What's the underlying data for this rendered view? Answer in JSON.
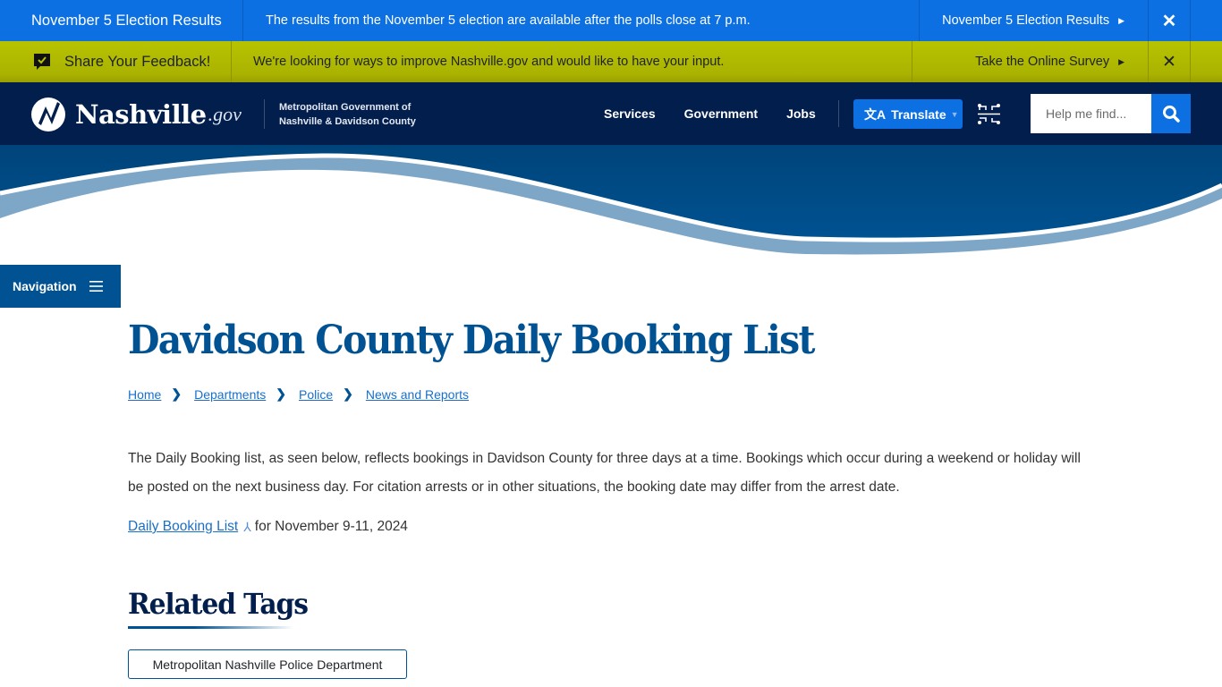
{
  "alerts": {
    "election": {
      "title": "November 5 Election Results",
      "message": "The results from the November 5 election are available after the polls close at 7 p.m.",
      "link_label": "November 5 Election Results",
      "close_label": "✕"
    },
    "feedback": {
      "title": "Share Your Feedback!",
      "message": "We're looking for ways to improve Nashville.gov and would like to have your input.",
      "link_label": "Take the Online Survey",
      "close_label": "✕"
    }
  },
  "header": {
    "logo_word": "Nashville",
    "logo_suffix": ".gov",
    "org_line1": "Metropolitan Government of",
    "org_line2": "Nashville & Davidson County",
    "nav": [
      "Services",
      "Government",
      "Jobs"
    ],
    "translate_label": "Translate",
    "search_placeholder": "Help me find..."
  },
  "navigation_toggle": {
    "label": "Navigation"
  },
  "page": {
    "title": "Davidson County Daily Booking List",
    "breadcrumb": [
      "Home",
      "Departments",
      "Police",
      "News and Reports"
    ],
    "intro": "The Daily Booking list, as seen below, reflects bookings in Davidson County for three days at a time. Bookings which occur during a weekend or holiday will be posted on the next business day. For citation arrests or in other situations, the booking date may differ from the arrest date.",
    "booking_link_label": "Daily Booking List",
    "booking_suffix": "for November 9-11, 2024",
    "related_title": "Related Tags",
    "tags": [
      "Metropolitan Nashville Police Department"
    ]
  },
  "colors": {
    "alert_blue": "#0c70e3",
    "alert_lime": "#b2bd00",
    "header_navy": "#021e4c",
    "brand_blue": "#005292",
    "link_blue": "#1a6fc9",
    "wave_light": "#7ea6c7"
  }
}
